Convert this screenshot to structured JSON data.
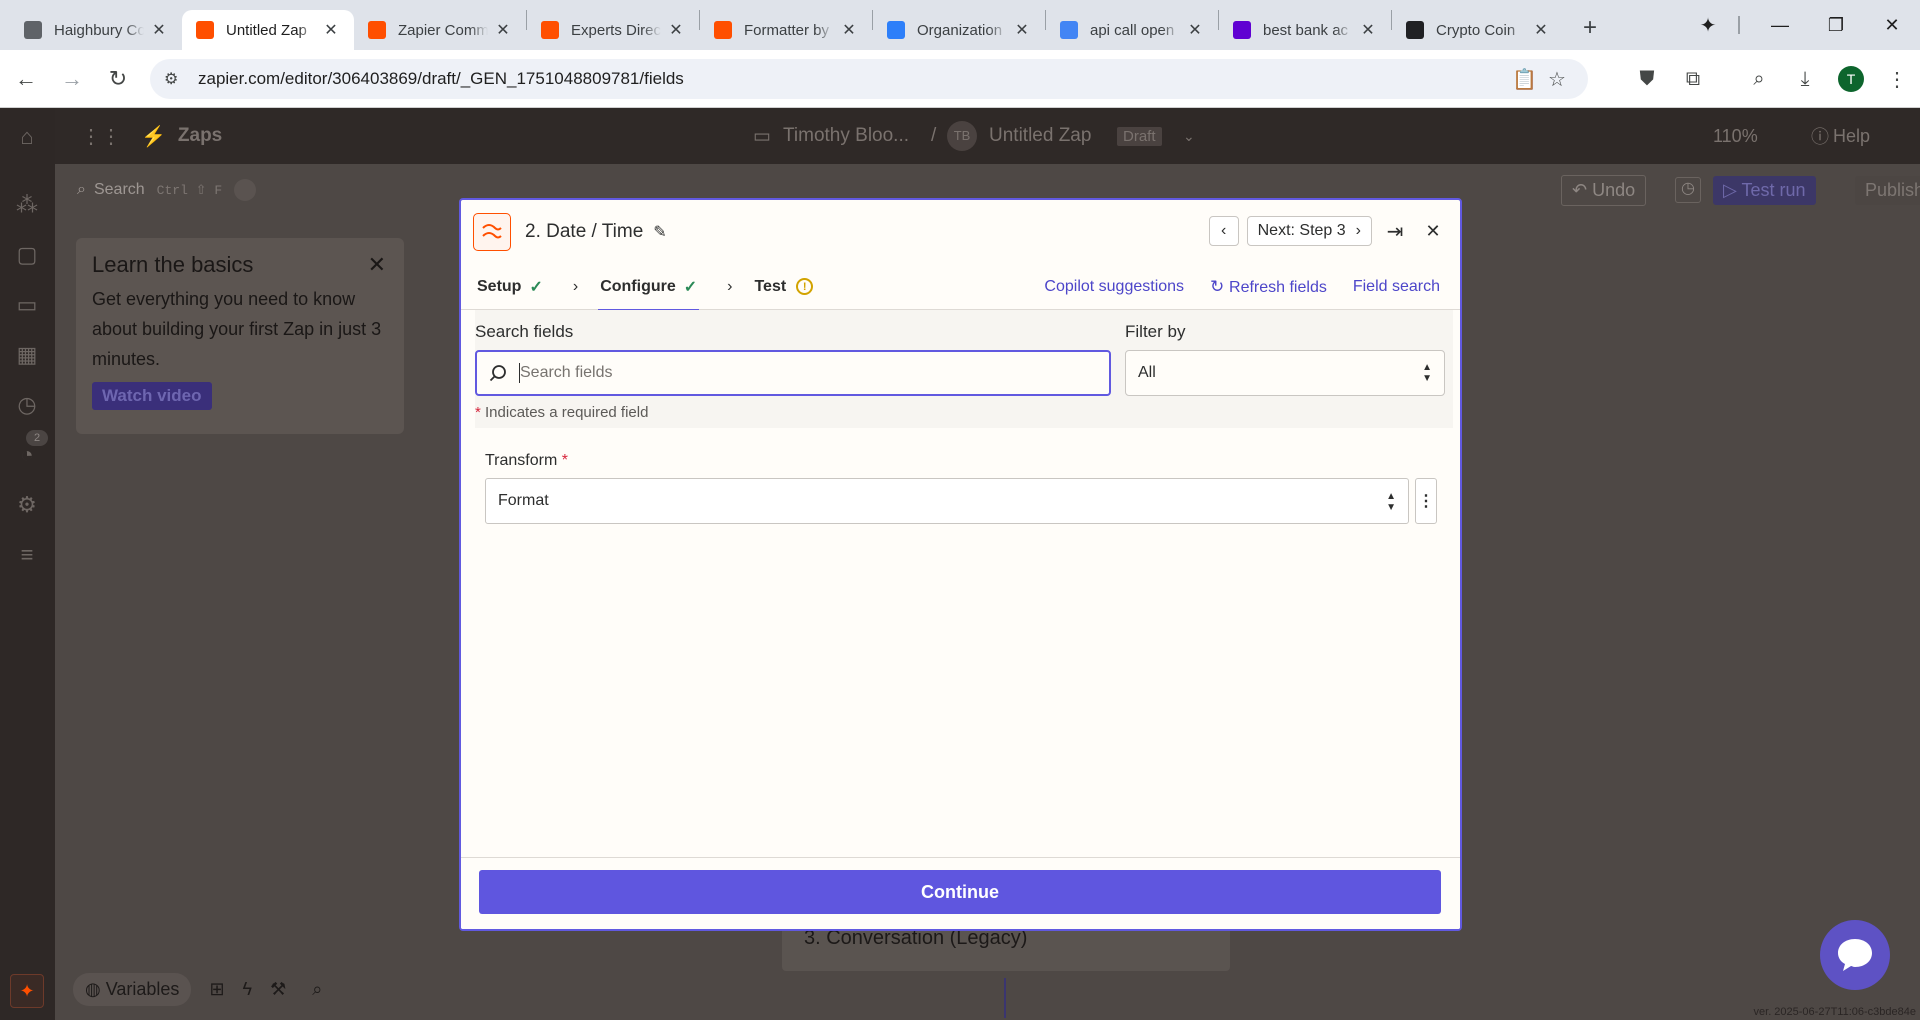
{
  "browser": {
    "tabs": [
      {
        "title": "Haighbury Co",
        "favicon_color": "#5f6368",
        "active": false
      },
      {
        "title": "Untitled Zap",
        "favicon_color": "#ff4f00",
        "active": true
      },
      {
        "title": "Zapier Comm",
        "favicon_color": "#ff4f00",
        "active": false
      },
      {
        "title": "Experts Direc",
        "favicon_color": "#ff4f00",
        "active": false
      },
      {
        "title": "Formatter by",
        "favicon_color": "#ff4f00",
        "active": false
      },
      {
        "title": "Organization",
        "favicon_color": "#2d7ff9",
        "active": false
      },
      {
        "title": "api call open",
        "favicon_color": "#4285f4",
        "active": false
      },
      {
        "title": "best bank ac",
        "favicon_color": "#6001d2",
        "active": false
      },
      {
        "title": "Crypto Coin",
        "favicon_color": "#202124",
        "active": false
      }
    ],
    "url": "zapier.com/editor/306403869/draft/_GEN_1751048809781/fields",
    "profile_initial": "T"
  },
  "app": {
    "brand": "Zaps",
    "breadcrumb_folder": "Timothy Bloo...",
    "breadcrumb_sep": "/",
    "owner_initials": "TB",
    "zap_name": "Untitled Zap",
    "zap_status": "Draft",
    "zoom": "110%",
    "help": "Help",
    "search_label": "Search",
    "search_shortcut": "Ctrl ⇧ F",
    "undo": "Undo",
    "test_run": "Test run",
    "publish": "Publish",
    "nav_badge": "2",
    "learn": {
      "title": "Learn the basics",
      "body": "Get everything you need to know about building your first Zap in just 3 minutes.",
      "cta": "Watch video"
    },
    "step3_title": "3. Conversation (Legacy)",
    "variables": "Variables",
    "version": "ver. 2025-06-27T11:06-c3bde84e"
  },
  "modal": {
    "title": "2. Date / Time",
    "next_step": "Next: Step 3",
    "tabs": [
      {
        "label": "Setup",
        "state": "done"
      },
      {
        "label": "Configure",
        "state": "done"
      },
      {
        "label": "Test",
        "state": "warning"
      }
    ],
    "links": {
      "copilot": "Copilot suggestions",
      "refresh": "Refresh fields",
      "field_search": "Field search"
    },
    "search_label": "Search fields",
    "search_placeholder": "Search fields",
    "filter_label": "Filter by",
    "filter_value": "All",
    "required_note": "Indicates a required field",
    "transform_label": "Transform",
    "transform_value": "Format",
    "continue": "Continue"
  },
  "colors": {
    "accent": "#6159e0",
    "zapier_orange": "#ff4f00",
    "success": "#2b8a57",
    "warning": "#d2a300",
    "required": "#d7263d"
  }
}
